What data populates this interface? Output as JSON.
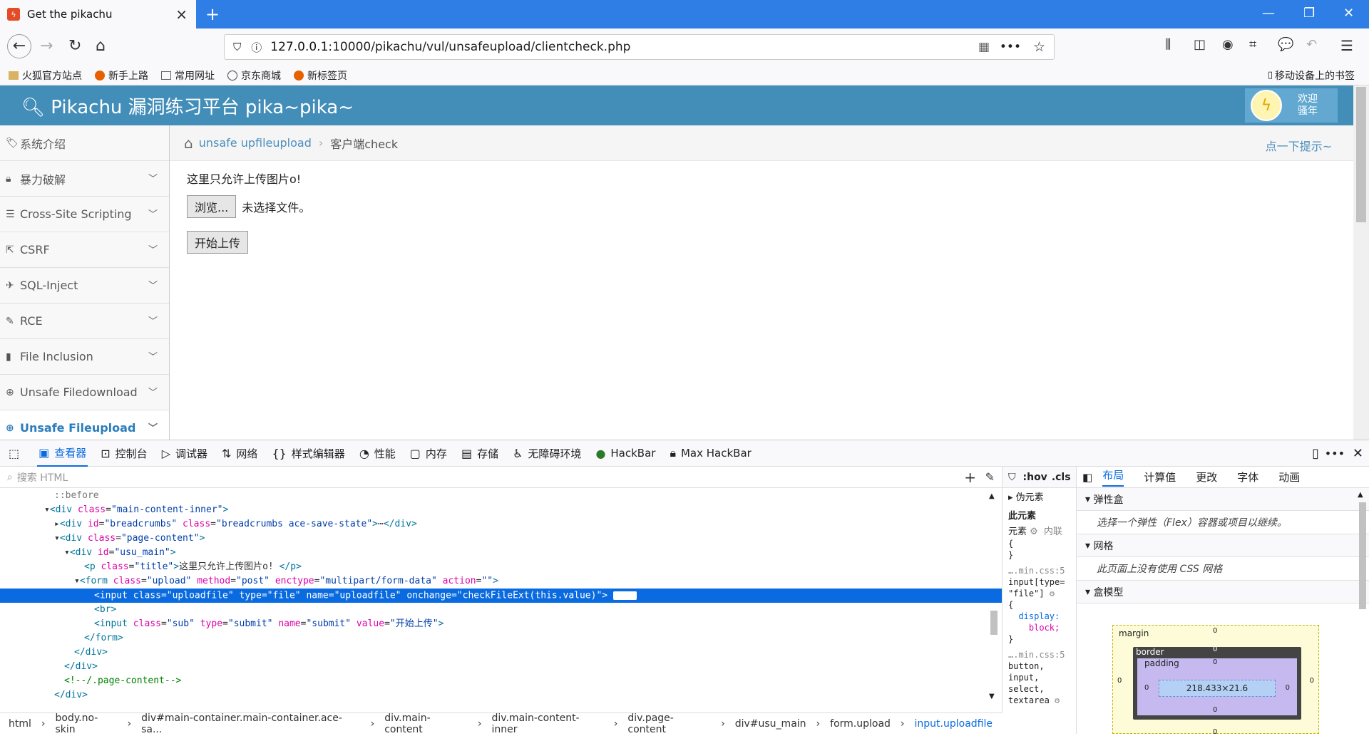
{
  "browser": {
    "tab_title": "Get the pikachu",
    "tab_icon": "pikachu-favicon",
    "url_host": "127.0.0.1",
    "url_rest": ":10000/pikachu/vul/unsafeupload/clientcheck.php",
    "bookmarks": [
      "火狐官方站点",
      "新手上路",
      "常用网址",
      "京东商城",
      "新标签页"
    ],
    "mobile_bookmarks": "移动设备上的书签"
  },
  "site": {
    "brand": "Pikachu 漏洞练习平台 pika~pika~",
    "welcome_line1": "欢迎",
    "welcome_line2": "骚年",
    "header_color": "#438eb9"
  },
  "sidebar": {
    "items": [
      {
        "label": "系统介绍",
        "icon": "tag-icon"
      },
      {
        "label": "暴力破解",
        "icon": "lock-icon"
      },
      {
        "label": "Cross-Site Scripting",
        "icon": "list-icon"
      },
      {
        "label": "CSRF",
        "icon": "share-icon"
      },
      {
        "label": "SQL-Inject",
        "icon": "plane-icon"
      },
      {
        "label": "RCE",
        "icon": "pencil-icon"
      },
      {
        "label": "File Inclusion",
        "icon": "file-icon"
      },
      {
        "label": "Unsafe Filedownload",
        "icon": "download-icon"
      },
      {
        "label": "Unsafe Fileupload",
        "icon": "upload-icon",
        "active": true
      }
    ]
  },
  "breadcrumb": {
    "link": "unsafe upfileupload",
    "current": "客户端check",
    "hint": "点一下提示~"
  },
  "content": {
    "title": "这里只允许上传图片o!",
    "browse_label": "浏览...",
    "no_file": "未选择文件。",
    "submit_label": "开始上传"
  },
  "devtools": {
    "tabs": [
      {
        "label": "查看器",
        "selected": true
      },
      {
        "label": "控制台"
      },
      {
        "label": "调试器"
      },
      {
        "label": "网络"
      },
      {
        "label": "样式编辑器"
      },
      {
        "label": "性能"
      },
      {
        "label": "内存"
      },
      {
        "label": "存储"
      },
      {
        "label": "无障碍环境"
      },
      {
        "label": "HackBar"
      },
      {
        "label": "Max HackBar"
      }
    ],
    "search_placeholder": "搜索 HTML",
    "tree": {
      "l0": "::before",
      "l1_tag": "div",
      "l1_attr": "class",
      "l1_val": "\"main-content-inner\"",
      "l2_id": "\"breadcrumbs\"",
      "l2_class": "\"breadcrumbs ace-save-state\"",
      "l3_val": "\"page-content\"",
      "l4_val": "\"usu_main\"",
      "l5_val": "\"title\"",
      "l5_text": "这里只允许上传图片o!",
      "l6_class": "\"upload\"",
      "l6_method": "\"post\"",
      "l6_enctype": "\"multipart/form-data\"",
      "l6_action": "\"\"",
      "l7_class": "\"uploadfile\"",
      "l7_type": "\"file\"",
      "l7_name": "\"uploadfile\"",
      "l7_onchange": "\"checkFileExt(this.value)\"",
      "event": "event",
      "l9_class": "\"sub\"",
      "l9_type": "\"submit\"",
      "l9_name": "\"submit\"",
      "l9_value": "\"开始上传\"",
      "comment": "<!--/.page-content-->"
    },
    "crumbs": [
      "html",
      "body.no-skin",
      "div#main-container.main-container.ace-sa...",
      "div.main-content",
      "div.main-content-inner",
      "div.page-content",
      "div#usu_main",
      "form.upload",
      "input.uploadfile"
    ],
    "rules": {
      "pseudo": "伪元素",
      "this_element": "此元素",
      "element": "元素",
      "inline": "内联",
      "src1": "….min.css:5",
      "selector1a": "input[type=",
      "selector1b": "\"file\"]",
      "prop": "display:",
      "value": "block;",
      "src2": "….min.css:5",
      "selector2": "button,",
      "selector2b": "input,",
      "selector2c": "select,",
      "selector2d": "textarea"
    },
    "filter_hov": ":hov",
    "filter_cls": ".cls",
    "layout_tabs": [
      "布局",
      "计算值",
      "更改",
      "字体",
      "动画"
    ],
    "flex_title": "弹性盒",
    "flex_body": "选择一个弹性（Flex）容器或项目以继续。",
    "grid_title": "网格",
    "grid_body": "此页面上没有使用 CSS 网格",
    "box_title": "盒模型",
    "box": {
      "margin": "margin",
      "border": "border",
      "padding": "padding",
      "size": "218.433×21.6",
      "zero": "0"
    }
  }
}
